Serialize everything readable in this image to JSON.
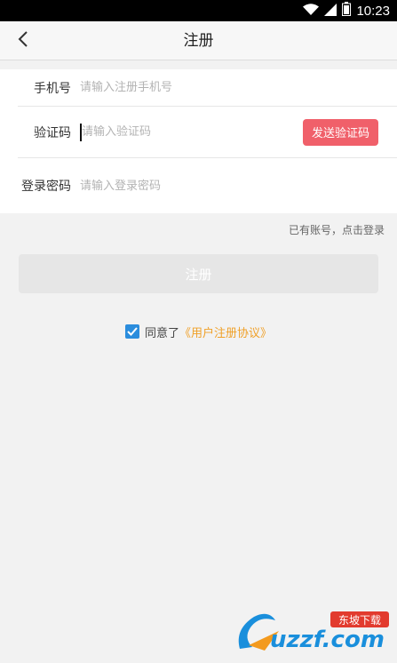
{
  "status_bar": {
    "time": "10:23",
    "icons": [
      "wifi-icon",
      "signal-icon",
      "battery-icon"
    ]
  },
  "header": {
    "title": "注册",
    "back_icon": "chevron-left-icon"
  },
  "form": {
    "phone": {
      "label": "手机号",
      "placeholder": "请输入注册手机号",
      "value": ""
    },
    "code": {
      "label": "验证码",
      "placeholder": "请输入验证码",
      "value": "",
      "send_button": "发送验证码"
    },
    "password": {
      "label": "登录密码",
      "placeholder": "请输入登录密码",
      "value": ""
    }
  },
  "login_link": "已有账号，点击登录",
  "register_button": "注册",
  "agreement": {
    "checked": true,
    "prefix": "同意了",
    "link_text": "《用户注册协议》"
  },
  "watermark": {
    "logo_text": "uzzf.com",
    "badge_text": "东坡下载"
  },
  "colors": {
    "accent_red": "#f0606a",
    "link_orange": "#f0a028",
    "checkbox_blue": "#2b8ddd",
    "background": "#f2f2f2",
    "disabled_button": "#e6e6e6"
  }
}
